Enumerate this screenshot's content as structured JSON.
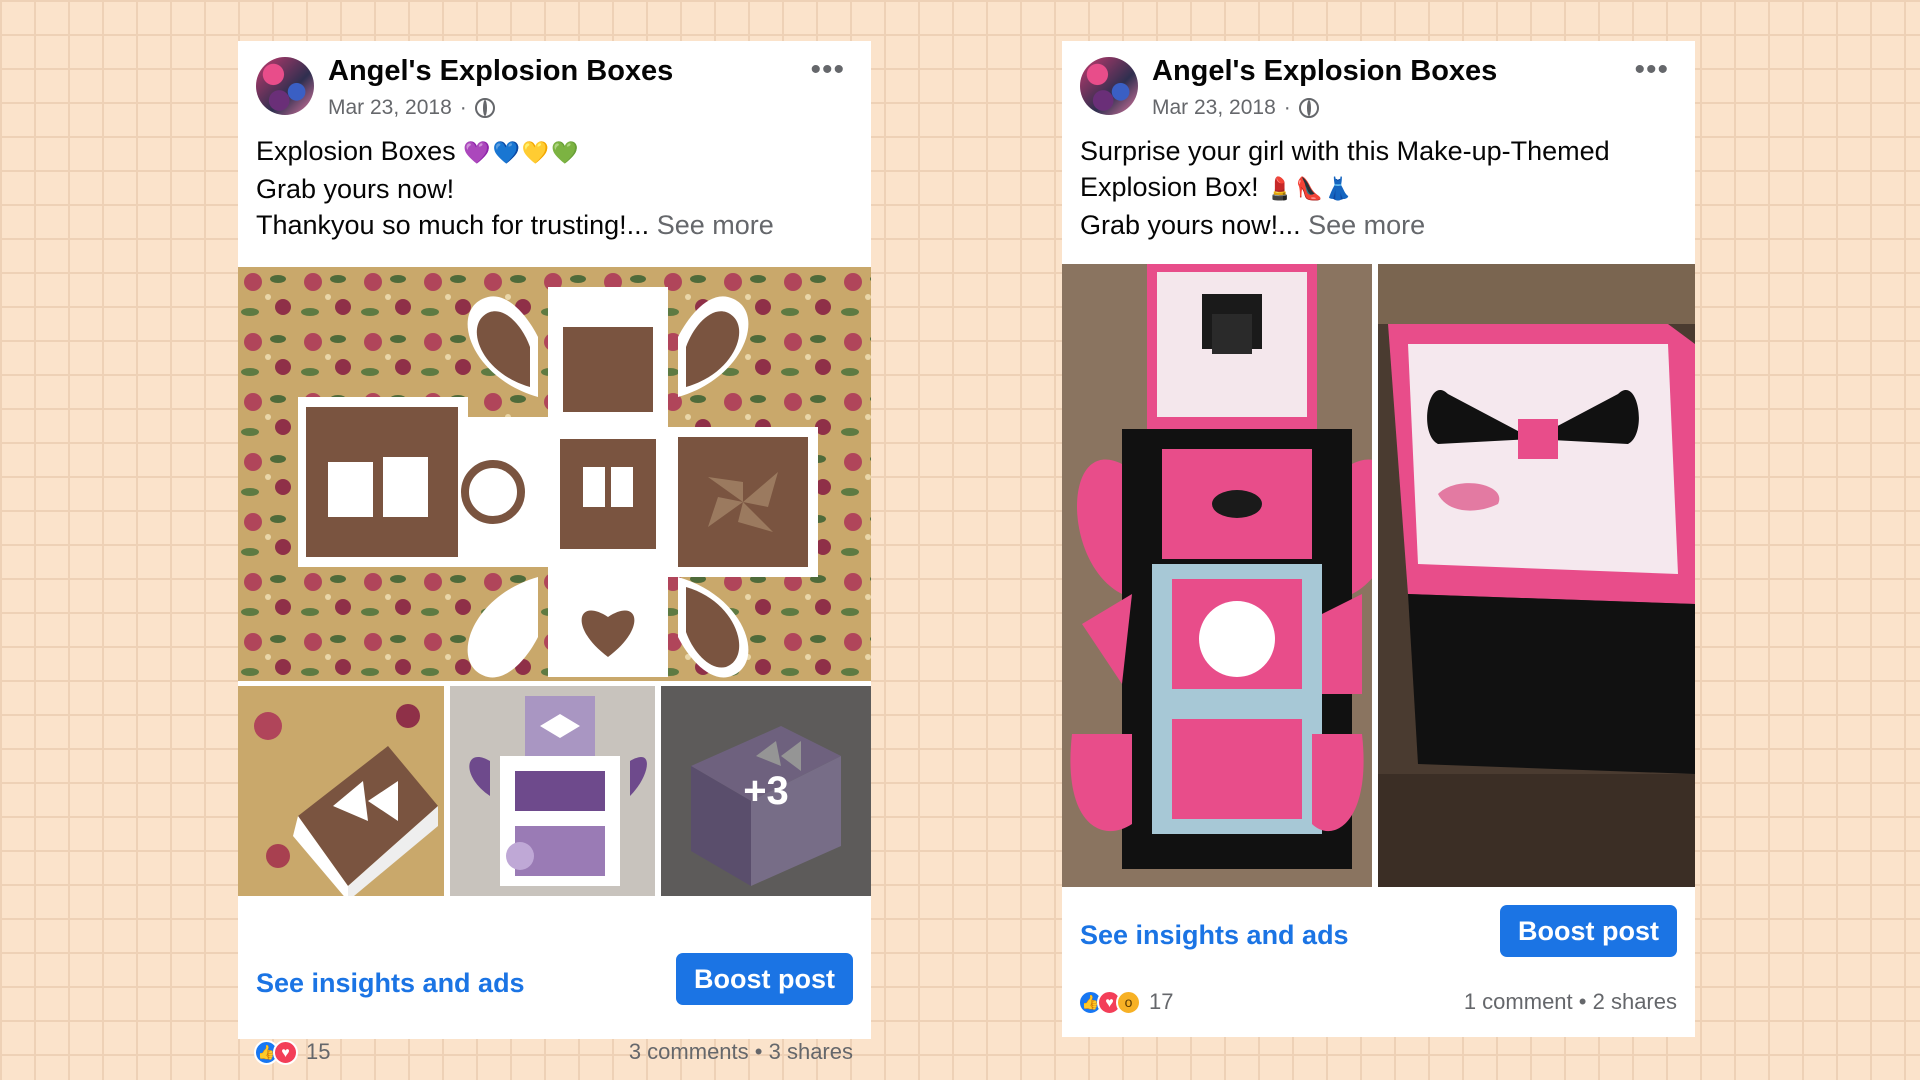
{
  "colors": {
    "background": "#fbe3cb",
    "link": "#1b74e4",
    "button": "#1b74e4",
    "muted": "#65676b"
  },
  "posts": [
    {
      "page_name": "Angel's Explosion Boxes",
      "date": "Mar 23, 2018",
      "privacy_icon": "globe-icon",
      "caption_line1": "Explosion Boxes",
      "caption_line1_emoji": "💜💙💛💚",
      "caption_line2": "Grab yours now!",
      "caption_line3": "Thankyou so much for trusting!...",
      "see_more": "See more",
      "more_photos_count": "+3",
      "insights_label": "See insights and ads",
      "boost_label": "Boost post",
      "reactions": [
        "like-icon",
        "love-icon"
      ],
      "reaction_count": "15",
      "comments": "3 comments",
      "separator": "•",
      "shares": "3 shares"
    },
    {
      "page_name": "Angel's Explosion Boxes",
      "date": "Mar 23, 2018",
      "privacy_icon": "globe-icon",
      "caption_line1": "Surprise your girl with this Make-up-Themed",
      "caption_line2": "Explosion Box!",
      "caption_line2_emoji": "💄👠👗",
      "caption_line3": "Grab yours now!...",
      "see_more": "See more",
      "insights_label": "See insights and ads",
      "boost_label": "Boost post",
      "reactions": [
        "like-icon",
        "love-icon",
        "wow-icon"
      ],
      "reaction_count": "17",
      "comments": "1 comment",
      "separator": "•",
      "shares": "2 shares"
    }
  ]
}
